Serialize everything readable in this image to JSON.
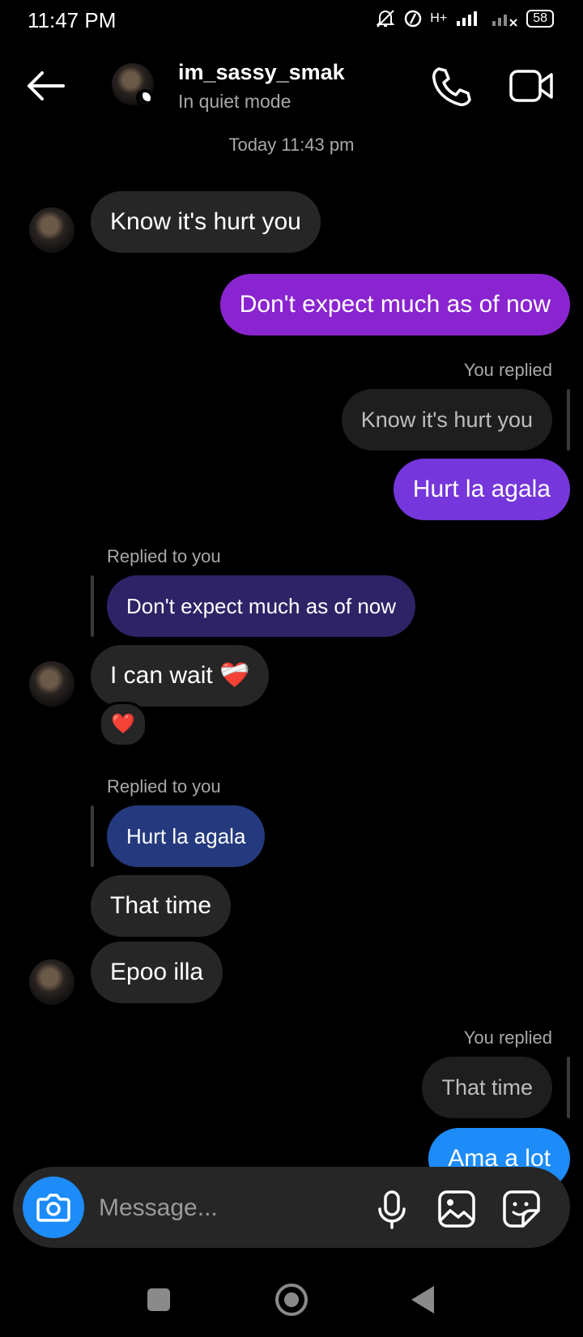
{
  "status_bar": {
    "time": "11:47 PM",
    "network": "H+",
    "battery": "58"
  },
  "header": {
    "username": "im_sassy_smak",
    "subtitle": "In quiet mode",
    "icons": [
      "back-arrow-icon",
      "phone-icon",
      "video-camera-icon"
    ]
  },
  "conversation": {
    "timestamp": "Today 11:43 pm",
    "messages": [
      {
        "text": "Know it's hurt you"
      },
      {
        "text": "Don't expect much as of now"
      },
      {
        "label": "You replied",
        "quoted": "Know it's hurt you",
        "text": "Hurt la agala"
      },
      {
        "label": "Replied to you",
        "quoted": "Don't expect much as of now",
        "text": "I can wait ❤️‍🩹",
        "reaction": "❤️"
      },
      {
        "label": "Replied to you",
        "quoted": "Hurt la agala",
        "text": "That time"
      },
      {
        "text": "Epoo illa"
      },
      {
        "label": "You replied",
        "quoted": "That time",
        "text": "Ama a lot"
      }
    ]
  },
  "composer": {
    "placeholder": "Message...",
    "icons": [
      "camera-icon",
      "microphone-icon",
      "gallery-icon",
      "sticker-icon"
    ]
  },
  "colors": {
    "outgoing_1": "#8a24d0",
    "outgoing_2": "#7536dc",
    "outgoing_3": "#1d8cf8",
    "quoted_purple": "#2e2366",
    "quoted_blue": "#253a7e",
    "camera_button": "#1d8cf8"
  }
}
